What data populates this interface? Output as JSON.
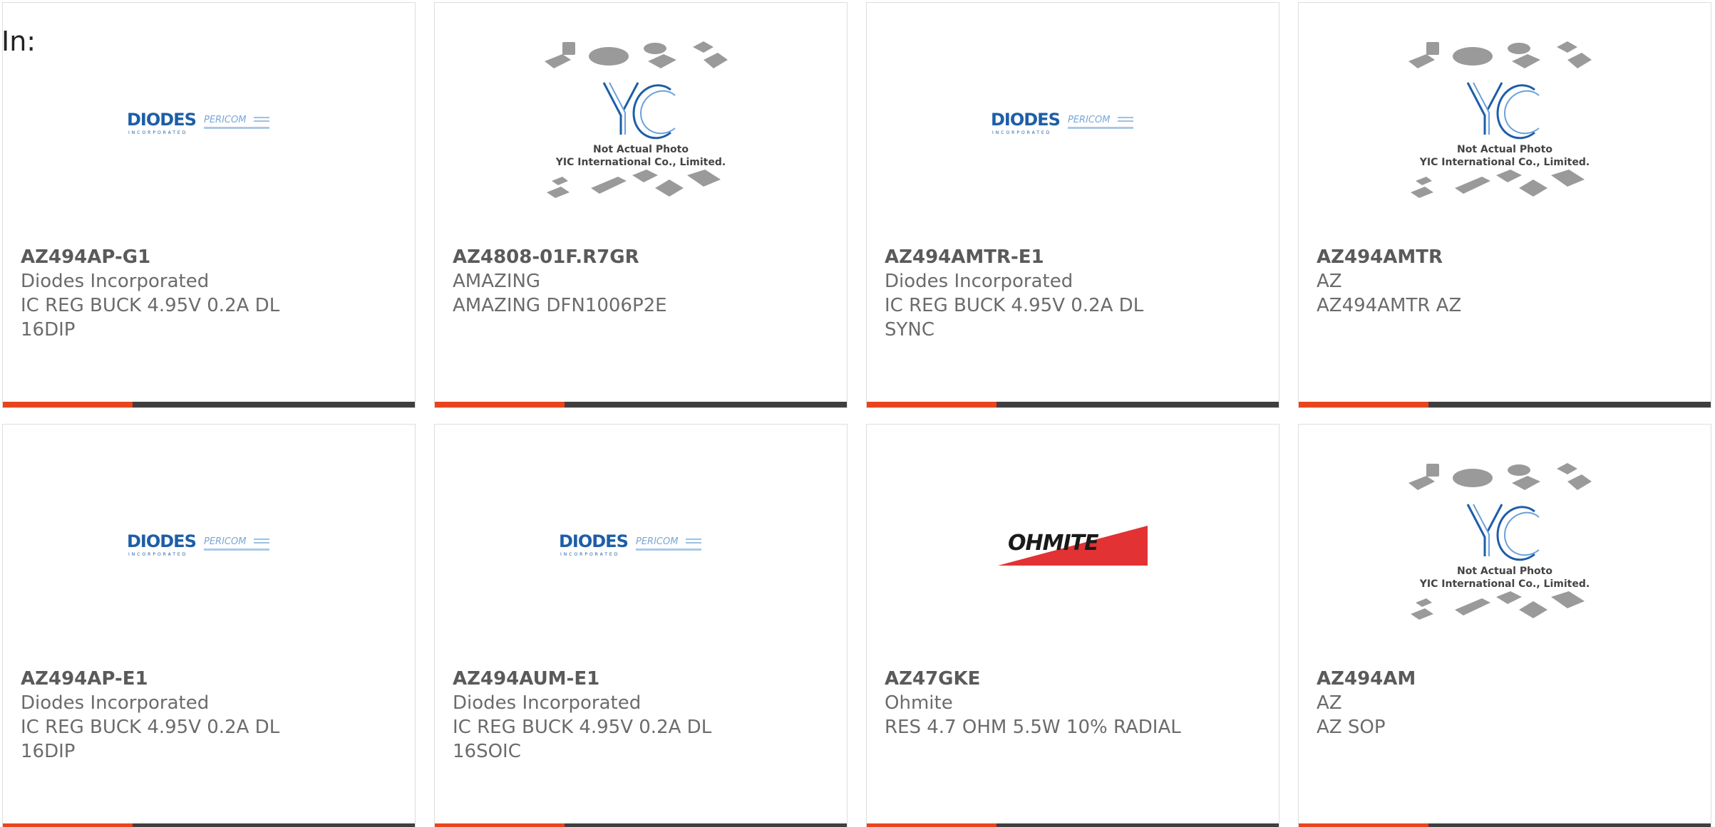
{
  "header": {
    "label": "In:"
  },
  "colors": {
    "accent": "#e8451f",
    "bar": "#3f3f3f",
    "diodes_blue": "#1d5ea8",
    "ohmite_red": "#e23234"
  },
  "logos": {
    "diodes": {
      "name": "DIODES",
      "sub": "INCORPORATED",
      "partner": "PERICOM"
    },
    "ohmite": {
      "name": "OHMITE"
    },
    "yic": {
      "name": "YIC",
      "caption1": "Not Actual Photo",
      "caption2": "YIC International Co., Limited."
    }
  },
  "products": [
    {
      "logo": "diodes",
      "part_number": "AZ494AP-G1",
      "manufacturer": "Diodes Incorporated",
      "description": "IC REG BUCK 4.95V 0.2A DL 16DIP"
    },
    {
      "logo": "yic",
      "part_number": "AZ4808-01F.R7GR",
      "manufacturer": "AMAZING",
      "description": "AMAZING DFN1006P2E"
    },
    {
      "logo": "diodes",
      "part_number": "AZ494AMTR-E1",
      "manufacturer": "Diodes Incorporated",
      "description": "IC REG BUCK 4.95V 0.2A DL SYNC"
    },
    {
      "logo": "yic",
      "part_number": "AZ494AMTR",
      "manufacturer": "AZ",
      "description": "AZ494AMTR AZ"
    },
    {
      "logo": "diodes",
      "part_number": "AZ494AP-E1",
      "manufacturer": "Diodes Incorporated",
      "description": "IC REG BUCK 4.95V 0.2A DL 16DIP"
    },
    {
      "logo": "diodes",
      "part_number": "AZ494AUM-E1",
      "manufacturer": "Diodes Incorporated",
      "description": "IC REG BUCK 4.95V 0.2A DL 16SOIC"
    },
    {
      "logo": "ohmite",
      "part_number": "AZ47GKE",
      "manufacturer": "Ohmite",
      "description": "RES 4.7 OHM 5.5W 10% RADIAL"
    },
    {
      "logo": "yic",
      "part_number": "AZ494AM",
      "manufacturer": "AZ",
      "description": "AZ SOP"
    }
  ]
}
